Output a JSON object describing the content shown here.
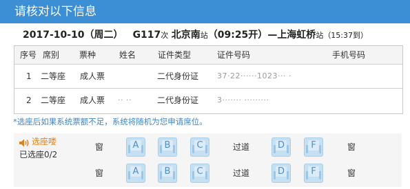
{
  "header": {
    "title": "请核对以下信息"
  },
  "train": {
    "date": "2017-10-10（周二）",
    "number": "G117",
    "number_suffix": "次",
    "from": "北京南",
    "from_suffix": "站",
    "depart": "（09:25开）",
    "dash": "—",
    "to": "上海虹桥",
    "to_suffix": "站",
    "arrive": "（15:37到）"
  },
  "table": {
    "columns": [
      "序号",
      "席别",
      "票种",
      "姓名",
      "证件类型",
      "证件号码",
      "手机号码"
    ],
    "rows": [
      {
        "no": "1",
        "seat_class": "二等座",
        "ticket_type": "成人票",
        "name": "",
        "id_type": "二代身份证",
        "id_number": "37·22······1023··· ·",
        "phone": ""
      },
      {
        "no": "2",
        "seat_class": "二等座",
        "ticket_type": "成人票",
        "name": "·· ··",
        "id_type": "二代身份证",
        "id_number": "3·······  ·········",
        "phone": ""
      }
    ]
  },
  "note": "*选座后如果系统票额不足，系统将随机为您申请席位。",
  "seat_selection": {
    "link": "选座喽",
    "count": "已选座0/2",
    "window_label": "窗",
    "aisle_label": "过道",
    "rows": [
      [
        "A",
        "B",
        "C",
        "D",
        "F"
      ],
      [
        "A",
        "B",
        "C",
        "D",
        "F"
      ]
    ]
  },
  "colors": {
    "header_bg": "#3d8fd5",
    "note_text": "#3e86c9",
    "seat_link": "#e0811d",
    "seat_bg": "#c5dff3"
  }
}
